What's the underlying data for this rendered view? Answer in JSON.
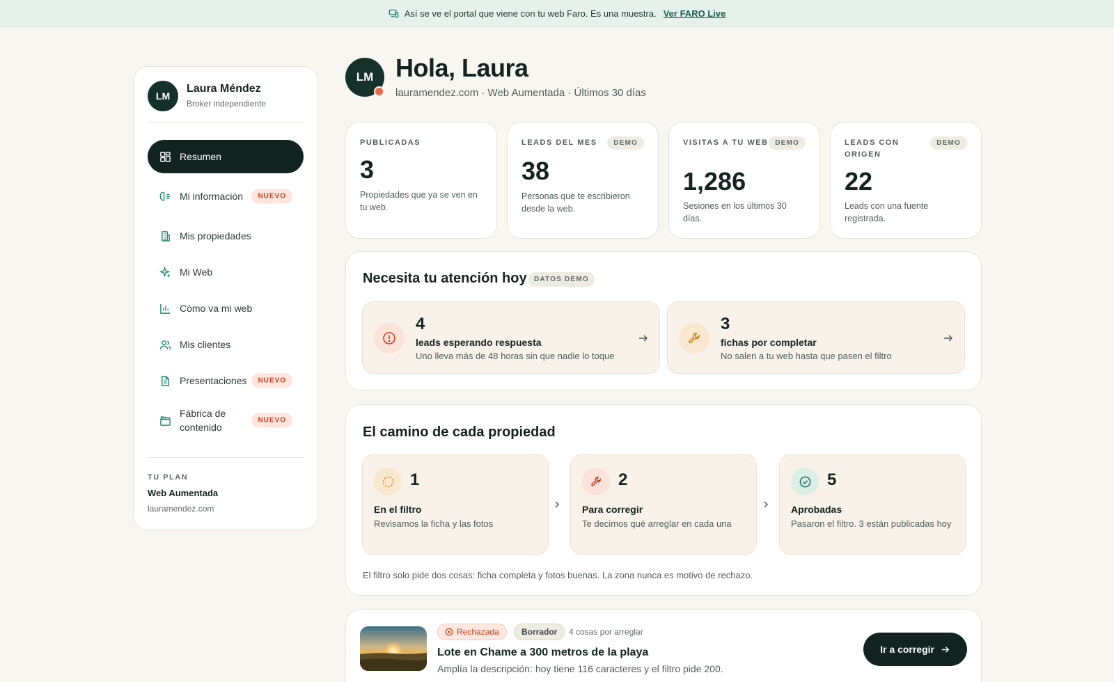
{
  "banner": {
    "text": "Así se ve el portal que viene con tu web Faro. Es una muestra.",
    "link": "Ver FARO Live"
  },
  "sidebar": {
    "initials": "LM",
    "name": "Laura Méndez",
    "role": "Broker independiente",
    "items": [
      {
        "label": "Resumen",
        "icon": "grid-icon"
      },
      {
        "label": "Mi información",
        "icon": "brain-icon",
        "badge": "NUEVO"
      },
      {
        "label": "Mis propiedades",
        "icon": "building-icon"
      },
      {
        "label": "Mi Web",
        "icon": "sparkle-icon"
      },
      {
        "label": "Cómo va mi web",
        "icon": "bar-chart-icon"
      },
      {
        "label": "Mis clientes",
        "icon": "users-icon"
      },
      {
        "label": "Presentaciones",
        "icon": "document-icon",
        "badge": "NUEVO"
      },
      {
        "label": "Fábrica de contenido",
        "icon": "clapperboard-icon",
        "badge": "NUEVO"
      }
    ],
    "plan": {
      "label": "TU PLAN",
      "name": "Web Aumentada",
      "domain": "lauramendez.com"
    }
  },
  "header": {
    "initials": "LM",
    "greeting": "Hola, Laura",
    "subline": "lauramendez.com · Web Aumentada · Últimos 30 días"
  },
  "stats": [
    {
      "label": "PUBLICADAS",
      "value": "3",
      "desc": "Propiedades que ya se ven en tu web."
    },
    {
      "label": "LEADS DEL MES",
      "demo": "DEMO",
      "value": "38",
      "desc": "Personas que te escribieron desde la web."
    },
    {
      "label": "VISITAS A TU WEB",
      "demo": "DEMO",
      "value": "1,286",
      "desc": "Sesiones en los últimos 30 días."
    },
    {
      "label": "LEADS CON ORIGEN",
      "demo": "DEMO",
      "value": "22",
      "desc": "Leads con una fuente registrada."
    }
  ],
  "attention": {
    "title": "Necesita tu atención hoy",
    "chip": "DATOS DEMO",
    "items": [
      {
        "count": "4",
        "title": "leads esperando respuesta",
        "desc": "Uno lleva más de 48 horas sin que nadie lo toque"
      },
      {
        "count": "3",
        "title": "fichas por completar",
        "desc": "No salen a tu web hasta que pasen el filtro"
      }
    ]
  },
  "pipeline": {
    "title": "El camino de cada propiedad",
    "stages": [
      {
        "count": "1",
        "title": "En el filtro",
        "desc": "Revisamos la ficha y las fotos"
      },
      {
        "count": "2",
        "title": "Para corregir",
        "desc": "Te decimos qué arreglar en cada una"
      },
      {
        "count": "5",
        "title": "Aprobadas",
        "desc": "Pasaron el filtro. 3 están publicadas hoy"
      }
    ],
    "note": "El filtro solo pide dos cosas: ficha completa y fotos buenas. La zona nunca es motivo de rechazo."
  },
  "property": {
    "status_rejected": "Rechazada",
    "status_draft": "Borrador",
    "fixes": "4 cosas por arreglar",
    "title": "Lote en Chame a 300 metros de la playa",
    "desc": "Amplía la descripción: hoy tiene 116 caracteres y el filtro pide 200.",
    "button": "Ir a corregir"
  },
  "colors": {
    "accent": "#1f8a70",
    "dark": "#12241f",
    "danger": "#c8401e",
    "warning": "#c9861f"
  }
}
